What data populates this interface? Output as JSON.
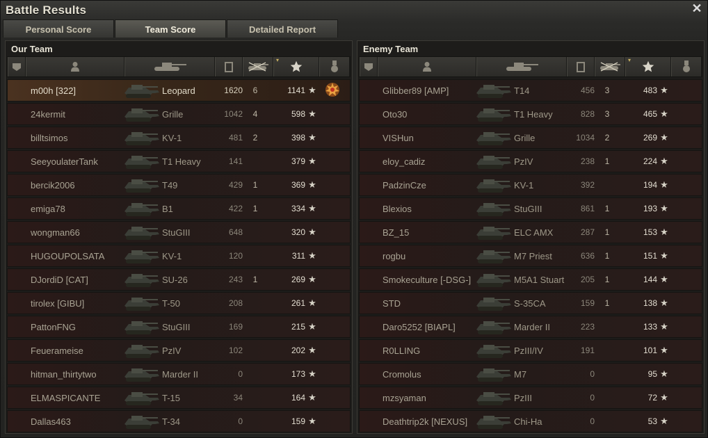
{
  "window": {
    "title": "Battle Results"
  },
  "tabs": [
    {
      "label": "Personal Score",
      "active": false
    },
    {
      "label": "Team Score",
      "active": true
    },
    {
      "label": "Detailed Report",
      "active": false
    }
  ],
  "our_team": {
    "title": "Our Team",
    "rows": [
      {
        "player": "m00h [322]",
        "vehicle": "Leopard",
        "damage": "1620",
        "kills": "6",
        "xp": "1141",
        "medal": "medal-icon",
        "highlight": true
      },
      {
        "player": "24kermit",
        "vehicle": "Grille",
        "damage": "1042",
        "kills": "4",
        "xp": "598"
      },
      {
        "player": "billtsimos",
        "vehicle": "KV-1",
        "damage": "481",
        "kills": "2",
        "xp": "398"
      },
      {
        "player": "SeeyoulaterTank",
        "vehicle": "T1 Heavy",
        "damage": "141",
        "kills": "",
        "xp": "379"
      },
      {
        "player": "bercik2006",
        "vehicle": "T49",
        "damage": "429",
        "kills": "1",
        "xp": "369"
      },
      {
        "player": "emiga78",
        "vehicle": "B1",
        "damage": "422",
        "kills": "1",
        "xp": "334"
      },
      {
        "player": "wongman66",
        "vehicle": "StuGIII",
        "damage": "648",
        "kills": "",
        "xp": "320"
      },
      {
        "player": "HUGOUPOLSATA",
        "vehicle": "KV-1",
        "damage": "120",
        "kills": "",
        "xp": "311"
      },
      {
        "player": "DJordiD [CAT]",
        "vehicle": "SU-26",
        "damage": "243",
        "kills": "1",
        "xp": "269"
      },
      {
        "player": "tirolex [GIBU]",
        "vehicle": "T-50",
        "damage": "208",
        "kills": "",
        "xp": "261"
      },
      {
        "player": "PattonFNG",
        "vehicle": "StuGIII",
        "damage": "169",
        "kills": "",
        "xp": "215"
      },
      {
        "player": "Feuerameise",
        "vehicle": "PzIV",
        "damage": "102",
        "kills": "",
        "xp": "202"
      },
      {
        "player": "hitman_thirtytwo",
        "vehicle": "Marder II",
        "damage": "0",
        "kills": "",
        "xp": "173"
      },
      {
        "player": "ELMASPICANTE",
        "vehicle": "T-15",
        "damage": "34",
        "kills": "",
        "xp": "164"
      },
      {
        "player": "Dallas463",
        "vehicle": "T-34",
        "damage": "0",
        "kills": "",
        "xp": "159"
      }
    ]
  },
  "enemy_team": {
    "title": "Enemy Team",
    "rows": [
      {
        "player": "Glibber89 [AMP]",
        "vehicle": "T14",
        "damage": "456",
        "kills": "3",
        "xp": "483"
      },
      {
        "player": "Oto30",
        "vehicle": "T1 Heavy",
        "damage": "828",
        "kills": "3",
        "xp": "465"
      },
      {
        "player": "VISHun",
        "vehicle": "Grille",
        "damage": "1034",
        "kills": "2",
        "xp": "269"
      },
      {
        "player": "eloy_cadiz",
        "vehicle": "PzIV",
        "damage": "238",
        "kills": "1",
        "xp": "224"
      },
      {
        "player": "PadzinCze",
        "vehicle": "KV-1",
        "damage": "392",
        "kills": "",
        "xp": "194"
      },
      {
        "player": "Blexios",
        "vehicle": "StuGIII",
        "damage": "861",
        "kills": "1",
        "xp": "193"
      },
      {
        "player": "BZ_15",
        "vehicle": "ELC AMX",
        "damage": "287",
        "kills": "1",
        "xp": "153"
      },
      {
        "player": "rogbu",
        "vehicle": "M7 Priest",
        "damage": "636",
        "kills": "1",
        "xp": "151"
      },
      {
        "player": "Smokeculture [-DSG-]",
        "vehicle": "M5A1 Stuart",
        "damage": "205",
        "kills": "1",
        "xp": "144"
      },
      {
        "player": "STD",
        "vehicle": "S-35CA",
        "damage": "159",
        "kills": "1",
        "xp": "138"
      },
      {
        "player": "Daro5252 [BIAPL]",
        "vehicle": "Marder II",
        "damage": "223",
        "kills": "",
        "xp": "133"
      },
      {
        "player": "R0LLING",
        "vehicle": "PzIII/IV",
        "damage": "191",
        "kills": "",
        "xp": "101"
      },
      {
        "player": "Cromolus",
        "vehicle": "M7",
        "damage": "0",
        "kills": "",
        "xp": "95"
      },
      {
        "player": "mzsyaman",
        "vehicle": "PzIII",
        "damage": "0",
        "kills": "",
        "xp": "72"
      },
      {
        "player": "Deathtrip2k [NEXUS]",
        "vehicle": "Chi-Ha",
        "damage": "0",
        "kills": "",
        "xp": "53"
      }
    ]
  },
  "columns": [
    "squad-icon",
    "player-icon",
    "tank-icon",
    "damage-icon",
    "kills-icon",
    "star-icon",
    "medal-icon"
  ],
  "star_glyph": "★",
  "colors": {
    "accent": "#c8b060",
    "row_bg": "#2a1c1a",
    "highlight_bg": "#4a3220"
  }
}
